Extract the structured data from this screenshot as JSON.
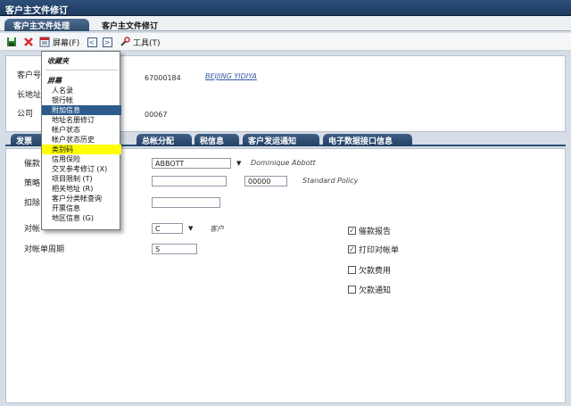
{
  "window": {
    "title": "客户主文件修订"
  },
  "tabs": [
    {
      "label": "客户主文件处理"
    },
    {
      "label": "客户主文件修订"
    }
  ],
  "toolbar": {
    "screen_label": "屏幕(F)",
    "tools_label": "工具(T)",
    "prev": "<",
    "next": ">"
  },
  "header": {
    "customer_no_label": "客户号",
    "customer_no_value": "67000184",
    "customer_name": "BEIJING YIDIYA",
    "long_address_label": "长地址",
    "company_label": "公司",
    "company_value": "00067"
  },
  "subtabs": [
    {
      "label": "发票"
    },
    {
      "label": "总帐分配"
    },
    {
      "label": "税信息"
    },
    {
      "label": "客户发运通知"
    },
    {
      "label": "电子数据接口信息"
    }
  ],
  "form": {
    "collector_label": "催款",
    "collector_value": "ABBOTT",
    "collector_name": "Dominique Abbott",
    "policy_label": "策略",
    "policy_value": "00000",
    "policy_desc": "Standard Policy",
    "deduction_label": "扣除",
    "statement_label": "对帐",
    "statement_value": "C",
    "statement_desc": "客户",
    "statement_cycle_label": "对帐单周期",
    "statement_cycle_value": "S"
  },
  "checkboxes": [
    {
      "label": "催款报告",
      "checked": true
    },
    {
      "label": "打印对帐单",
      "checked": true
    },
    {
      "label": "欠款费用",
      "checked": false
    },
    {
      "label": "欠款通知",
      "checked": false
    }
  ],
  "menu": {
    "favorites": "收藏夹",
    "screen": "屏幕",
    "items": [
      {
        "label": "人名录",
        "state": "normal"
      },
      {
        "label": "银行帐",
        "state": "normal"
      },
      {
        "label": "附加信息",
        "state": "selected"
      },
      {
        "label": "地址名册修订",
        "state": "normal"
      },
      {
        "label": "帐户状态",
        "state": "normal"
      },
      {
        "label": "帐户状态历史",
        "state": "normal"
      },
      {
        "label": "类别码",
        "state": "highlighted"
      },
      {
        "label": "信用保险",
        "state": "normal"
      },
      {
        "label": "交叉参考修订 (X)",
        "state": "normal"
      },
      {
        "label": "项目限制 (T)",
        "state": "normal"
      },
      {
        "label": "相关地址 (R)",
        "state": "normal"
      },
      {
        "label": "客户分类帐查询",
        "state": "normal"
      },
      {
        "label": "开票信息",
        "state": "normal"
      },
      {
        "label": "地区信息 (G)",
        "state": "normal"
      }
    ]
  },
  "colors": {
    "highlight": "#ffff00",
    "selected": "#2e5a8c",
    "tab_active": "#31506f"
  }
}
